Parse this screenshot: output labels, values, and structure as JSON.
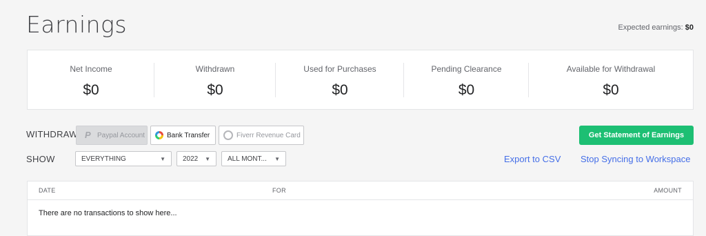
{
  "header": {
    "title": "Earnings",
    "expected_label": "Expected earnings:",
    "expected_value": "$0"
  },
  "stats": [
    {
      "label": "Net Income",
      "value": "$0"
    },
    {
      "label": "Withdrawn",
      "value": "$0"
    },
    {
      "label": "Used for Purchases",
      "value": "$0"
    },
    {
      "label": "Pending Clearance",
      "value": "$0"
    },
    {
      "label": "Available for Withdrawal",
      "value": "$0"
    }
  ],
  "withdraw": {
    "label": "WITHDRAW",
    "paypal": "Paypal Account",
    "bank": "Bank Transfer",
    "card": "Fiverr Revenue Card"
  },
  "statement_button": "Get Statement of Earnings",
  "show": {
    "label": "SHOW",
    "type_value": "EVERYTHING",
    "year_value": "2022",
    "month_value": "ALL MONT..."
  },
  "links": {
    "export": "Export to CSV",
    "sync": "Stop Syncing to Workspace"
  },
  "table": {
    "columns": [
      "DATE",
      "FOR",
      "AMOUNT"
    ],
    "empty_message": "There are no transactions to show here..."
  },
  "colors": {
    "accent_green": "#1dbf73",
    "link_blue": "#446ee7"
  }
}
